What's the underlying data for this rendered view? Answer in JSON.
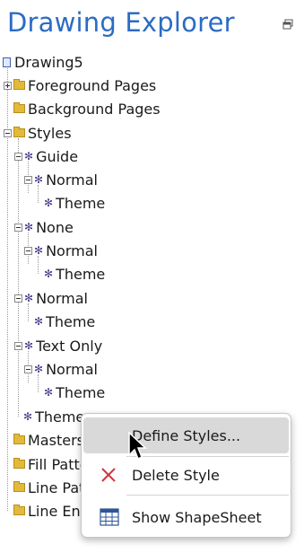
{
  "panel": {
    "title": "Drawing Explorer"
  },
  "tree": {
    "root": "Drawing5",
    "foreground": "Foreground Pages",
    "background": "Background Pages",
    "styles": "Styles",
    "guide": "Guide",
    "guide_normal": "Normal",
    "guide_theme": "Theme",
    "none": "None",
    "none_normal": "Normal",
    "none_theme": "Theme",
    "normal": "Normal",
    "normal_theme": "Theme",
    "textonly": "Text Only",
    "textonly_normal": "Normal",
    "textonly_theme": "Theme",
    "theme": "Theme",
    "masters": "Masters",
    "fill": "Fill Patte",
    "linepat": "Line Pat",
    "lineend": "Line End"
  },
  "menu": {
    "define_styles": "Define Styles...",
    "delete_style": "Delete Style",
    "show_shapesheet": "Show ShapeSheet"
  },
  "colors": {
    "title": "#2b6cc4",
    "delete_icon": "#d13438",
    "hover": "#d9d9d9"
  }
}
